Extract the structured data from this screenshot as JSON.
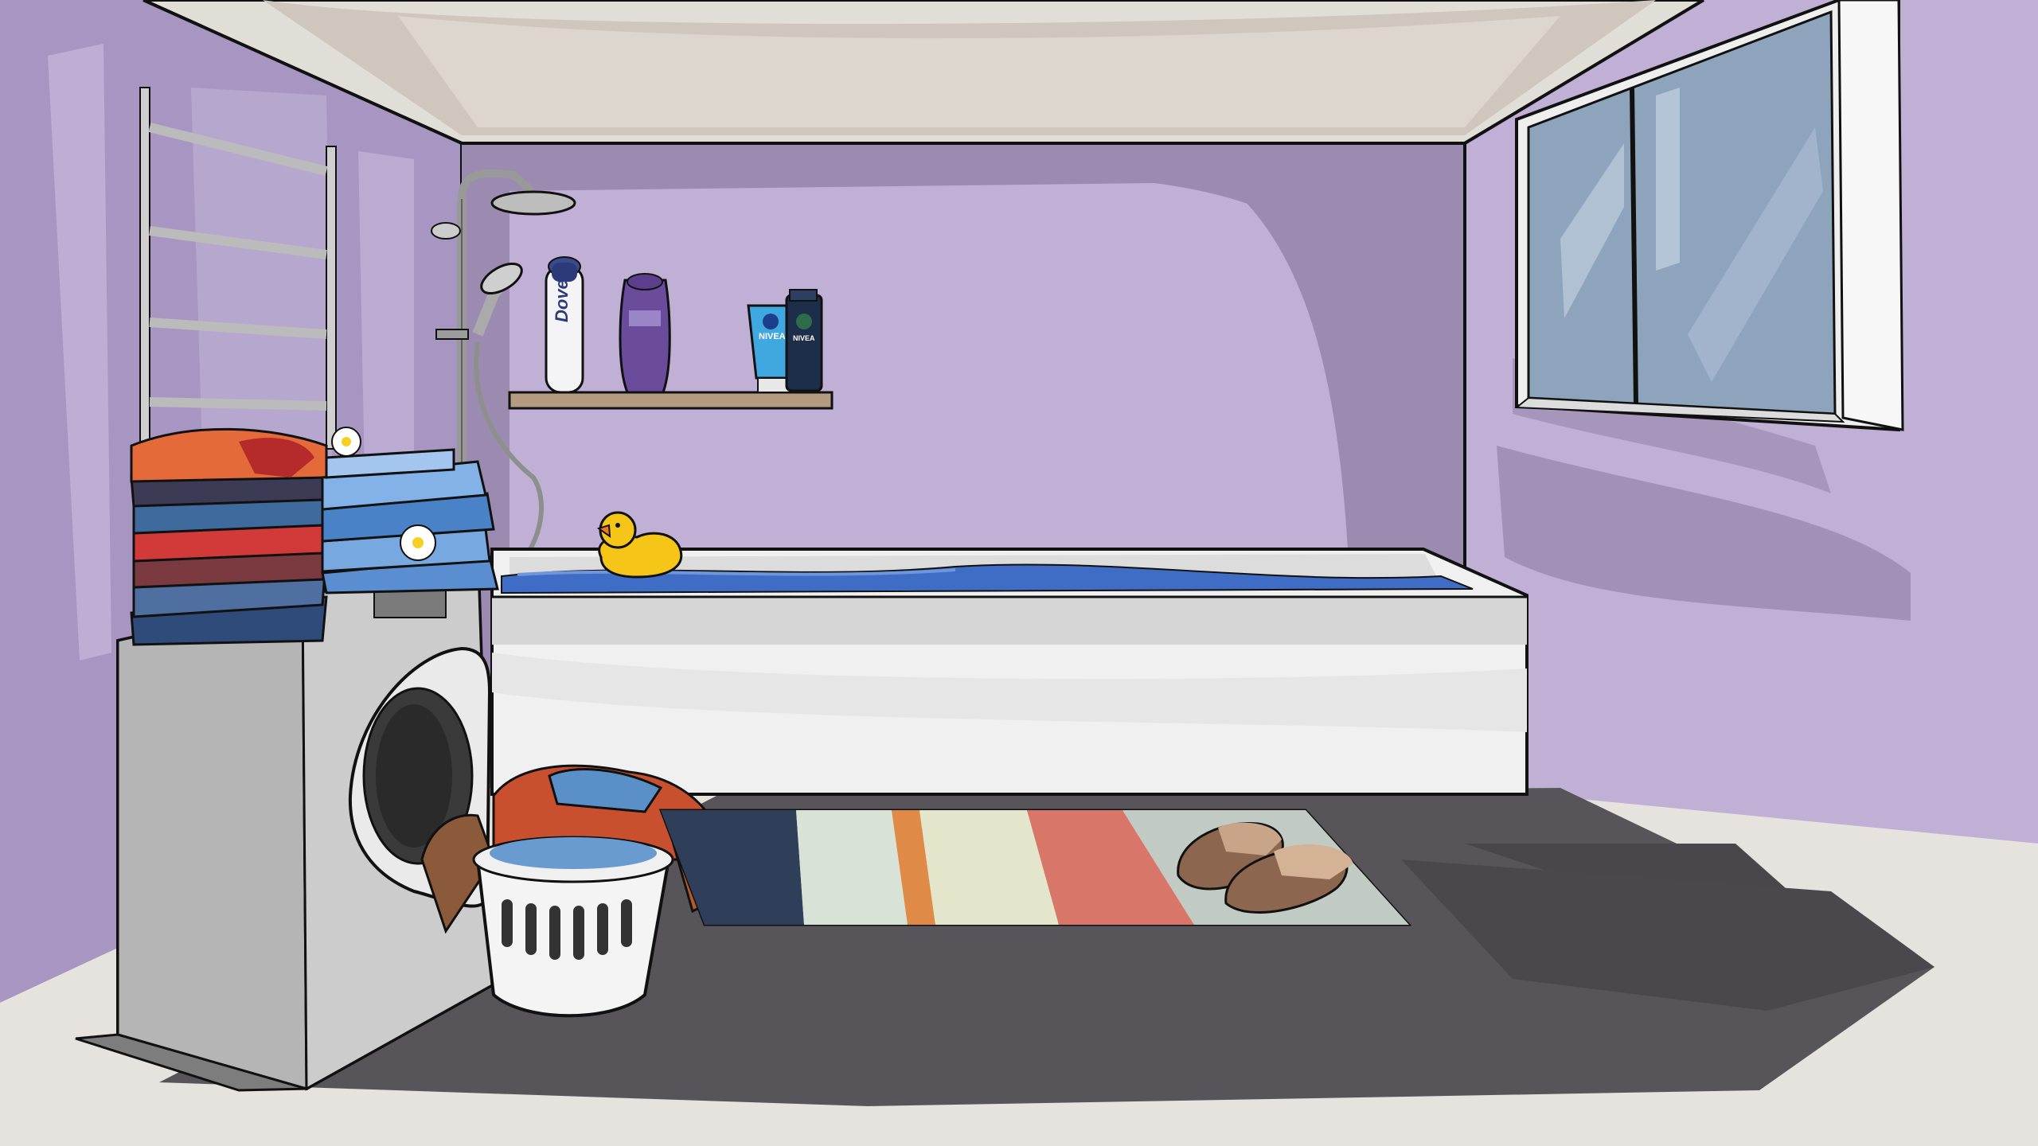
{
  "scene": {
    "room": "bathroom",
    "style": "cartoon illustration"
  },
  "products": {
    "deodorant_brand": "Dove",
    "lotion_brand": "NIVEA",
    "gel_brand": "NIVEA"
  },
  "colors": {
    "wall": "#c0b0d6",
    "wall_shadow": "#9a8ab0",
    "ceiling": "#e0dcd6",
    "floor_light": "#e6e2dd",
    "floor_dark": "#4f4d52",
    "tub": "#f2f2f2",
    "water": "#3f6cc4",
    "duck": "#f5c518",
    "washer": "#9a9a9a",
    "window_glass": "#8ea4bd",
    "rug_orange": "#e08a48",
    "rug_red": "#d9766a"
  },
  "icons": [
    "towel-rail-icon",
    "shower-head-icon",
    "rubber-duck-icon",
    "washing-machine-icon",
    "laundry-basket-icon",
    "slippers-icon",
    "window-icon",
    "bath-mat-icon"
  ]
}
